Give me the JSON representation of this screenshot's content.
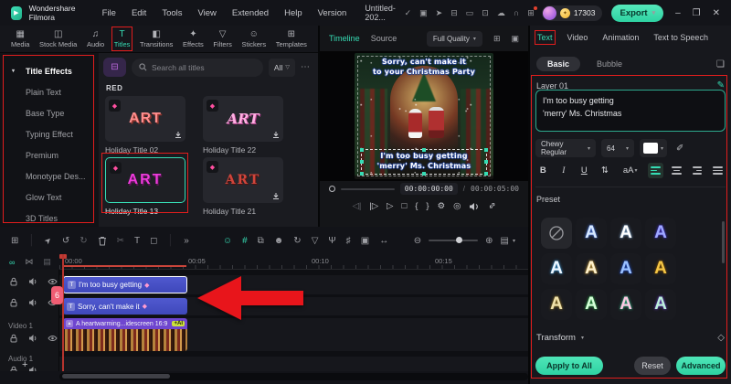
{
  "colors": {
    "accent": "#36dcb4",
    "annotation": "#e11d1d"
  },
  "titlebar": {
    "app_name": "Wondershare Filmora",
    "menus": [
      "File",
      "Edit",
      "Tools",
      "View",
      "Extended",
      "Help",
      "Version"
    ],
    "project_name": "Untitled-202...",
    "coin_count": "17303",
    "export_label": "Export",
    "window": {
      "minimize": "–",
      "maximize": "❐",
      "close": "✕"
    }
  },
  "media_tabs": {
    "items": [
      {
        "label": "Media",
        "icon": "▦"
      },
      {
        "label": "Stock Media",
        "icon": "◫"
      },
      {
        "label": "Audio",
        "icon": "♫"
      },
      {
        "label": "Titles",
        "icon": "T"
      },
      {
        "label": "Transitions",
        "icon": "◧"
      },
      {
        "label": "Effects",
        "icon": "✦"
      },
      {
        "label": "Filters",
        "icon": "▽"
      },
      {
        "label": "Stickers",
        "icon": "☺"
      },
      {
        "label": "Templates",
        "icon": "⊞"
      }
    ]
  },
  "sidebar": {
    "items": [
      "Title Effects",
      "Plain Text",
      "Base Type",
      "Typing Effect",
      "Premium",
      "Monotype Des...",
      "Glow Text",
      "3D Titles"
    ]
  },
  "library": {
    "search_placeholder": "Search all titles",
    "filter_all": "All",
    "section_label": "RED",
    "titles": [
      {
        "name": "Holiday Title 02",
        "word": "ART"
      },
      {
        "name": "Holiday Title 22",
        "word": "ART"
      },
      {
        "name": "Holiday Title 13",
        "word": "ART"
      },
      {
        "name": "Holiday Title 21",
        "word": "ART"
      }
    ]
  },
  "preview": {
    "tab_timeline": "Timeline",
    "tab_source": "Source",
    "quality_label": "Full Quality",
    "overlay_top_line1": "Sorry, can't make it",
    "overlay_top_line2": "to your Christmas Party",
    "overlay_bottom_line1": "I'm too busy getting",
    "overlay_bottom_line2": "'merry' Ms. Christmas",
    "timecode_current": "00:00:00:00",
    "timecode_separator": "/",
    "timecode_total": "00:00:05:00"
  },
  "properties": {
    "tabs": [
      "Text",
      "Video",
      "Animation",
      "Text to Speech"
    ],
    "subtab_basic": "Basic",
    "subtab_bubble": "Bubble",
    "layer_label": "Layer 01",
    "text_value": "I'm too busy getting\n'merry' Ms. Christmas",
    "font_name": "Chewy Regular",
    "font_size": "64",
    "format": {
      "bold": "B",
      "italic": "I",
      "underline": "U",
      "case_label": "aA"
    },
    "preset_label": "Preset",
    "presets": [
      {
        "none": true
      },
      {
        "letter": "A",
        "fill": "#d7e9ff",
        "glow": "#4f82f7"
      },
      {
        "letter": "A",
        "fill": "#ffffff",
        "glow": "#8fb8e0"
      },
      {
        "letter": "A",
        "fill": "#9fa8ff",
        "glow": "#4636d8"
      },
      {
        "letter": "A",
        "fill": "#eef7ff",
        "glow": "#3fa0e0"
      },
      {
        "letter": "A",
        "fill": "#fff2cd",
        "glow": "#e0b14a"
      },
      {
        "letter": "A",
        "fill": "#9cc2ff",
        "glow": "#2050d0"
      },
      {
        "letter": "A",
        "fill": "#f5c646",
        "glow": "#8a5800"
      },
      {
        "letter": "A",
        "fill": "#efe2ad",
        "glow": "#a2832c"
      },
      {
        "letter": "A",
        "fill": "#d6ffd9",
        "glow": "#2fae4a"
      },
      {
        "letter": "A",
        "fill": "#ffc8e4",
        "glow": "#35c78d"
      },
      {
        "letter": "A",
        "fill": "#bdf2da",
        "glow": "#6f3fd0"
      }
    ],
    "transform_label": "Transform",
    "apply_label": "Apply to All",
    "reset_label": "Reset",
    "advanced_label": "Advanced"
  },
  "timeline": {
    "ruler_labels": [
      "00:00",
      "00:05",
      "00:10",
      "00:15"
    ],
    "video_track_label": "Video 1",
    "audio_track_label": "Audio 1",
    "clips": [
      {
        "label": "I'm too busy getting"
      },
      {
        "label": "Sorry, can't make it"
      },
      {
        "label": "A heartwarming...idescreen 16:9",
        "badge": "+AI"
      }
    ],
    "marker_badge": "6"
  },
  "icons": {
    "logo_play": "▶",
    "check": "✓",
    "gift": "▣",
    "promote": "➤",
    "device": "⊟",
    "laptop": "▭",
    "save": "⊡",
    "cloud": "☁",
    "support": "∩",
    "apps": "⊞",
    "coin": "✦",
    "caret_down": "▾",
    "funnel": "▽",
    "more": "⋯",
    "folder": "⊟",
    "quality_grid": "⊞",
    "display": "▣",
    "prev_frame": "◁|",
    "next_frame": "|▷",
    "play": "▷",
    "stop": "□",
    "mark_in": "{",
    "mark_out": "}",
    "gear": "⚙",
    "snapshot": "◎",
    "expand": "⇕",
    "bookmark": "❏",
    "ai_pen": "✎",
    "dropper": "✐",
    "spacing": "⇅",
    "diamond_outline": "◇",
    "grid": "⊞",
    "pointer": "➤",
    "undo": "↺",
    "redo": "↻",
    "scissors": "✂",
    "text_tool": "T",
    "crop": "◻",
    "chevrons": "»",
    "face": "☺",
    "plugin": "#",
    "board": "⧉",
    "person": "☻",
    "rotate": "↻",
    "shield": "▽",
    "mic": "Ψ",
    "mixer": "♯",
    "film": "▣",
    "ripple": "↔",
    "zoom_out": "⊖",
    "zoom_in": "⊕",
    "track_view": "▤",
    "link": "∞",
    "chain": "⋈",
    "strip": "▤",
    "plus": "+",
    "diamond": "◆",
    "sep": "│",
    "clip_t": "T",
    "clip_v": "▲"
  }
}
